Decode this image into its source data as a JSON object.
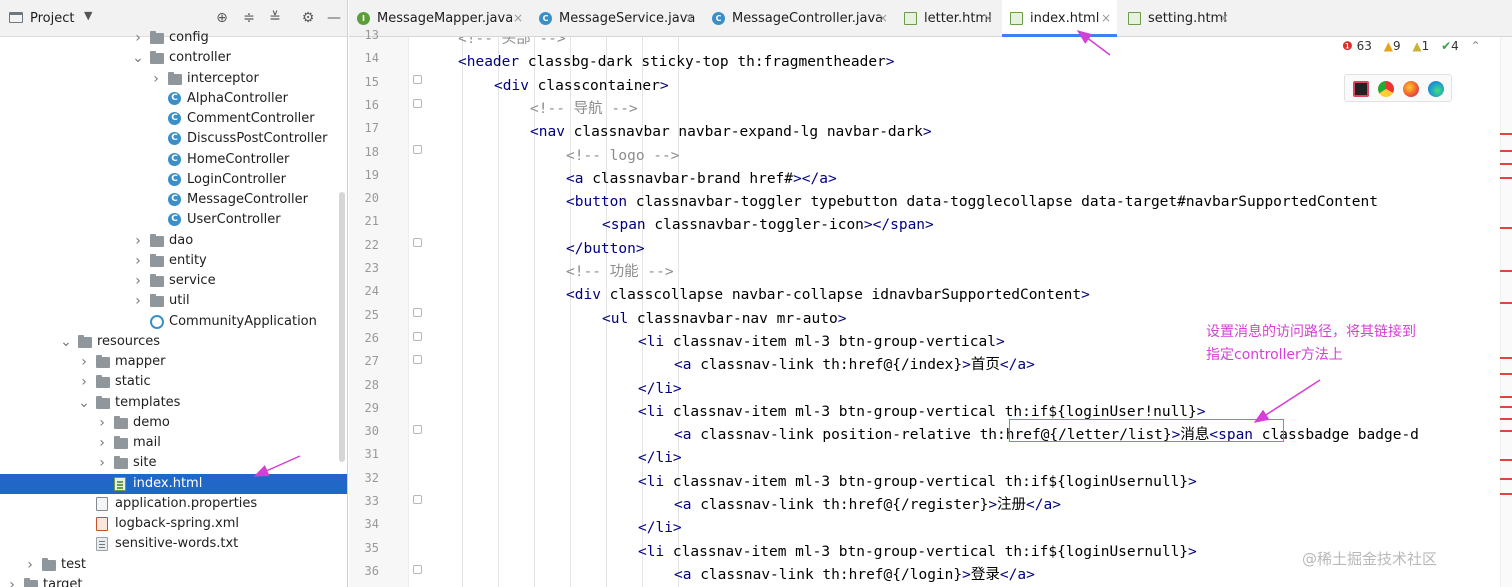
{
  "project": {
    "title": "Project",
    "tree": [
      {
        "label": "config",
        "icon": "folder-icon"
      },
      {
        "label": "controller",
        "icon": "folder-icon"
      },
      {
        "label": "interceptor",
        "icon": "folder-icon"
      },
      {
        "label": "AlphaController",
        "icon": "class-icon"
      },
      {
        "label": "CommentController",
        "icon": "class-icon"
      },
      {
        "label": "DiscussPostController",
        "icon": "class-icon"
      },
      {
        "label": "HomeController",
        "icon": "class-icon"
      },
      {
        "label": "LoginController",
        "icon": "class-icon"
      },
      {
        "label": "MessageController",
        "icon": "class-icon"
      },
      {
        "label": "UserController",
        "icon": "class-icon"
      },
      {
        "label": "dao",
        "icon": "folder-icon"
      },
      {
        "label": "entity",
        "icon": "folder-icon"
      },
      {
        "label": "service",
        "icon": "folder-icon"
      },
      {
        "label": "util",
        "icon": "folder-icon"
      },
      {
        "label": "CommunityApplication",
        "icon": "spring-app-icon"
      },
      {
        "label": "resources",
        "icon": "folder-icon"
      },
      {
        "label": "mapper",
        "icon": "folder-icon"
      },
      {
        "label": "static",
        "icon": "folder-icon"
      },
      {
        "label": "templates",
        "icon": "folder-icon"
      },
      {
        "label": "demo",
        "icon": "folder-icon"
      },
      {
        "label": "mail",
        "icon": "folder-icon"
      },
      {
        "label": "site",
        "icon": "folder-icon"
      },
      {
        "label": "index.html",
        "icon": "html-file-icon"
      },
      {
        "label": "application.properties",
        "icon": "properties-file-icon"
      },
      {
        "label": "logback-spring.xml",
        "icon": "xml-file-icon"
      },
      {
        "label": "sensitive-words.txt",
        "icon": "text-file-icon"
      },
      {
        "label": "test",
        "icon": "folder-icon"
      },
      {
        "label": "target",
        "icon": "folder-icon"
      }
    ]
  },
  "tabs": [
    {
      "label": "MessageMapper.java",
      "icon": "interface-icon"
    },
    {
      "label": "MessageService.java",
      "icon": "class-icon"
    },
    {
      "label": "MessageController.java",
      "icon": "class-icon"
    },
    {
      "label": "letter.html",
      "icon": "html-file-icon"
    },
    {
      "label": "index.html",
      "icon": "html-file-icon"
    },
    {
      "label": "setting.html",
      "icon": "html-file-icon"
    }
  ],
  "close_glyph": "×",
  "editor": {
    "line_numbers": [
      "13",
      "14",
      "15",
      "16",
      "17",
      "18",
      "19",
      "20",
      "21",
      "22",
      "23",
      "24",
      "25",
      "26",
      "27",
      "28",
      "29",
      "30",
      "31",
      "32",
      "33",
      "34",
      "35",
      "36"
    ],
    "lines": [
      "<!-- 头部 -->",
      "<header class=\"bg-dark sticky-top\" th:fragment=\"header\">",
      "<div class=\"container\">",
      "<!-- 导航 -->",
      "<nav class=\"navbar navbar-expand-lg navbar-dark\">",
      "<!-- logo -->",
      "<a class=\"navbar-brand\" href=\"#\"></a>",
      "<button class=\"navbar-toggler\" type=\"button\" data-toggle=\"collapse\" data-target=\"#navbarSupportedContent\"",
      "<span class=\"navbar-toggler-icon\"></span>",
      "</button>",
      "<!-- 功能 -->",
      "<div class=\"collapse navbar-collapse\" id=\"navbarSupportedContent\">",
      "<ul class=\"navbar-nav mr-auto\">",
      "<li class=\"nav-item ml-3 btn-group-vertical\">",
      "<a class=\"nav-link\" th:href=\"@{/index}\">首页</a>",
      "</li>",
      "<li class=\"nav-item ml-3 btn-group-vertical\" th:if=\"${loginUser!=null}\">",
      "<a class=\"nav-link position-relative\" th:href=\"@{/letter/list}\">消息<span class=\"badge badge-d",
      "</li>",
      "<li class=\"nav-item ml-3 btn-group-vertical\" th:if=\"${loginUser==null}\">",
      "<a class=\"nav-link\" th:href=\"@{/register}\">注册</a>",
      "</li>",
      "<li class=\"nav-item ml-3 btn-group-vertical\" th:if=\"${loginUser==null}\">",
      "<a class=\"nav-link\" th:href=\"@{/login}\">登录</a>"
    ]
  },
  "inspections": {
    "errors": "63",
    "warnings": "9",
    "weak_warnings": "1",
    "typos": "4"
  },
  "browsers": [
    "intellij-icon",
    "chrome-icon",
    "firefox-icon",
    "edge-icon"
  ],
  "annotation": {
    "line1": "设置消息的访问路径，将其链接到",
    "line2": "指定controller方法上"
  },
  "watermark": "@稀土掘金技术社区",
  "colors": {
    "selection": "#2167c8",
    "annotation": "#d63fd6",
    "active_tab_underline": "#3b82f6"
  }
}
